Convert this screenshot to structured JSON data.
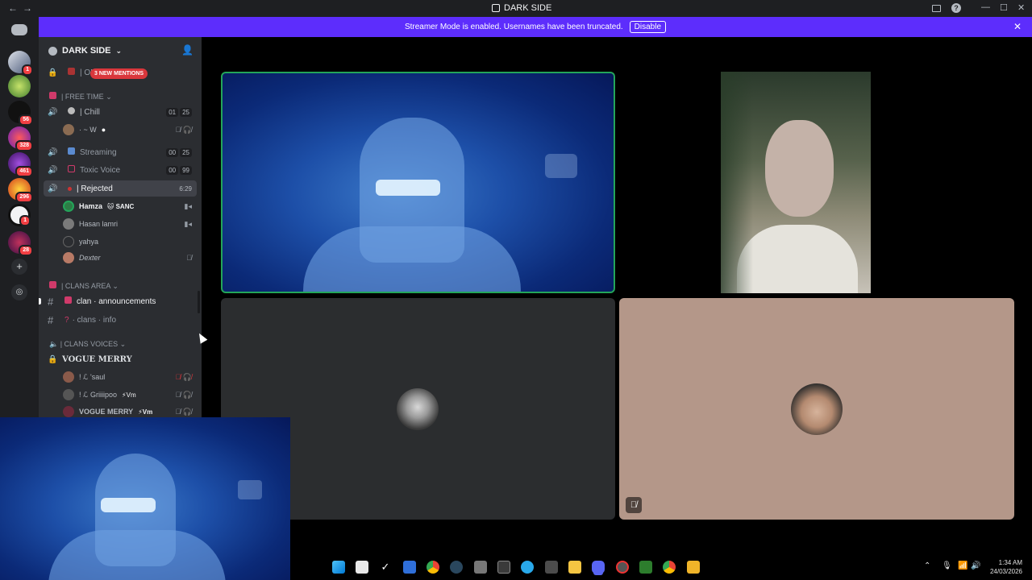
{
  "window": {
    "title": "DARK SIDE",
    "back_label": "←",
    "forward_label": "→",
    "inbox_icon": "inbox-icon",
    "help_label": "?",
    "minimize_label": "—",
    "maximize_label": "☐",
    "close_label": "✕"
  },
  "servers": {
    "home_icon": "discord-logo-icon",
    "badges": [
      "1",
      "56",
      "328",
      "461",
      "296",
      "1",
      "28"
    ],
    "add_label": "+",
    "explore_icon": "compass-icon"
  },
  "banner": {
    "message": "Streamer Mode is enabled. Usernames have been truncated.",
    "button": "Disable",
    "close_label": "✕"
  },
  "guild": {
    "name": "DARK SIDE",
    "chevron": "⌄",
    "invite_icon": "add-person-icon"
  },
  "mentions_pill": "3 NEW MENTIONS",
  "channels": {
    "top_channel": "| ON",
    "cat_free_time": "| FREE TIME",
    "chill": {
      "name": "| Chill",
      "counts": [
        "01",
        "25"
      ]
    },
    "chill_user": "· ~ W",
    "streaming": {
      "name": "Streaming",
      "counts": [
        "00",
        "25"
      ]
    },
    "toxic": {
      "name": "Toxic Voice",
      "counts": [
        "00",
        "99"
      ]
    },
    "rejected": {
      "name": "| Rejected",
      "timer": "6:29"
    },
    "rejected_users": [
      "Hamza",
      "Hasan lamri",
      "yahya",
      "Dexter"
    ],
    "hamza_tag": "🐱 SANC",
    "cat_clans_area": "| CLANS AREA",
    "clan_announcements": "clan · announcements",
    "clans_info": "· clans · info",
    "cat_clans_voices": "| CLANS VOICES",
    "vogue_merry": "VOGUE MERRY",
    "vogue_users": [
      "! ℒ 'saul",
      "! ℒ Griiiipoo",
      "VOGUE MERRY"
    ],
    "vm_tag": "⚡Vm"
  },
  "taskbar": {
    "tray_chevron": "⌃",
    "time": "1:34 AM",
    "date": "24/03/2026"
  },
  "colors": {
    "banner": "#5d2dfc",
    "speaking_border": "#23a55a",
    "sidebar": "#2b2d31",
    "rail": "#1e1f22"
  }
}
